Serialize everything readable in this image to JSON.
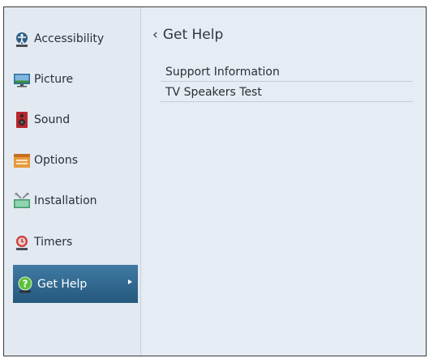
{
  "sidebar": {
    "items": [
      {
        "label": "Accessibility",
        "icon": "accessibility-icon"
      },
      {
        "label": "Picture",
        "icon": "picture-icon"
      },
      {
        "label": "Sound",
        "icon": "sound-icon"
      },
      {
        "label": "Options",
        "icon": "options-icon"
      },
      {
        "label": "Installation",
        "icon": "installation-icon"
      },
      {
        "label": "Timers",
        "icon": "timers-icon"
      },
      {
        "label": "Get Help",
        "icon": "get-help-icon",
        "selected": true
      }
    ]
  },
  "main": {
    "title": "Get Help",
    "menu": [
      {
        "label": "Support Information"
      },
      {
        "label": "TV Speakers Test"
      }
    ]
  },
  "colors": {
    "selected_gradient_top": "#3f7aa3",
    "selected_gradient_bottom": "#25587d",
    "panel_bg": "#e6ecf3"
  }
}
